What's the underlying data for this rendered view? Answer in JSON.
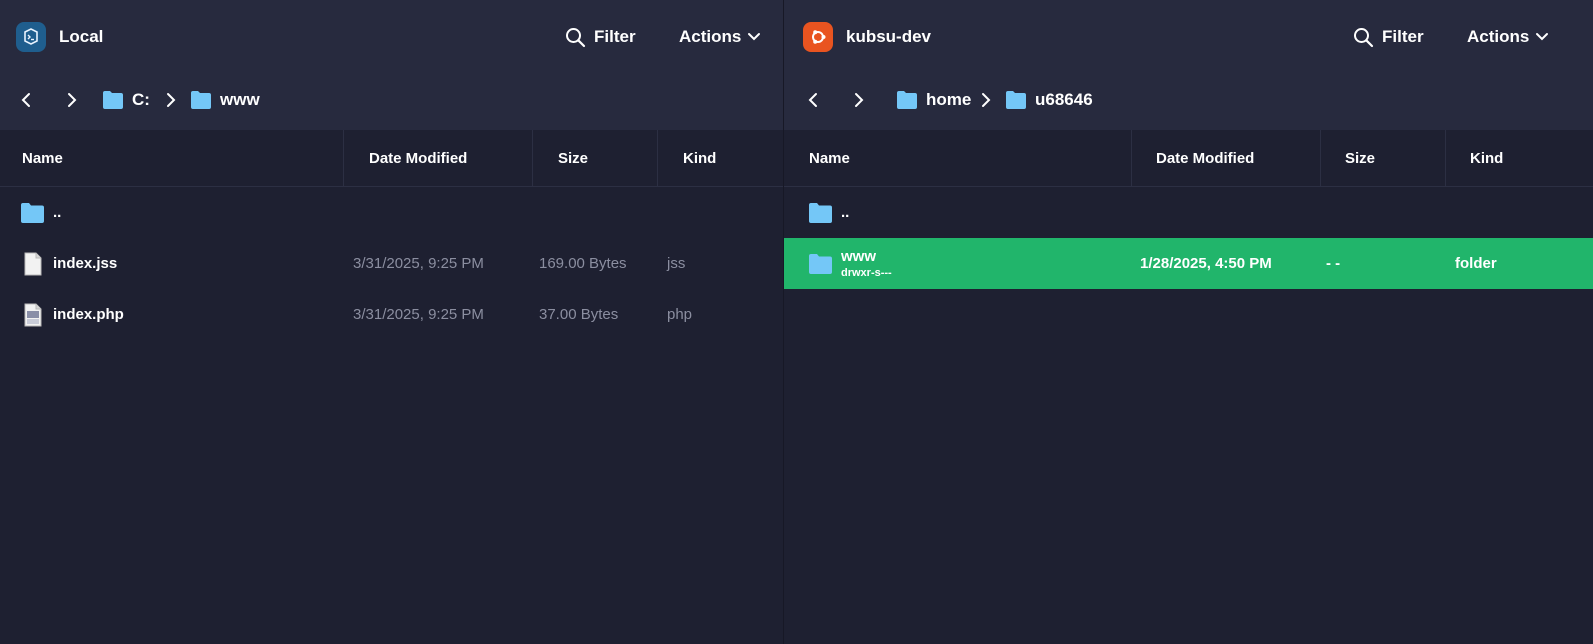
{
  "left_pane": {
    "host": {
      "name": "Local",
      "icon": "terminal-icon",
      "icon_color": "#1f5e8e"
    },
    "filter_label": "Filter",
    "actions_label": "Actions",
    "breadcrumb": [
      "C:",
      "www"
    ],
    "columns": {
      "name": "Name",
      "date": "Date Modified",
      "size": "Size",
      "kind": "Kind"
    },
    "rows": [
      {
        "name": "..",
        "icon": "folder-icon",
        "date": "",
        "size": "",
        "kind": ""
      },
      {
        "name": "index.jss",
        "icon": "file-icon",
        "date": "3/31/2025, 9:25 PM",
        "size": "169.00 Bytes",
        "kind": "jss"
      },
      {
        "name": "index.php",
        "icon": "php-file-icon",
        "date": "3/31/2025, 9:25 PM",
        "size": "37.00 Bytes",
        "kind": "php"
      }
    ]
  },
  "right_pane": {
    "host": {
      "name": "kubsu-dev",
      "icon": "ubuntu-icon",
      "icon_color": "#e95420"
    },
    "filter_label": "Filter",
    "actions_label": "Actions",
    "breadcrumb": [
      "home",
      "u68646"
    ],
    "columns": {
      "name": "Name",
      "date": "Date Modified",
      "size": "Size",
      "kind": "Kind"
    },
    "rows": [
      {
        "name": "..",
        "icon": "folder-icon",
        "permissions": "",
        "date": "",
        "size": "",
        "kind": ""
      },
      {
        "name": "www",
        "icon": "folder-icon",
        "permissions": "drwxr-s---",
        "date": "1/28/2025, 4:50 PM",
        "size": "- -",
        "kind": "folder",
        "selected": true
      }
    ]
  },
  "colors": {
    "background": "#1e2031",
    "header_bg": "#272a3e",
    "folder": "#74c7f7",
    "selection": "#21b56b"
  }
}
